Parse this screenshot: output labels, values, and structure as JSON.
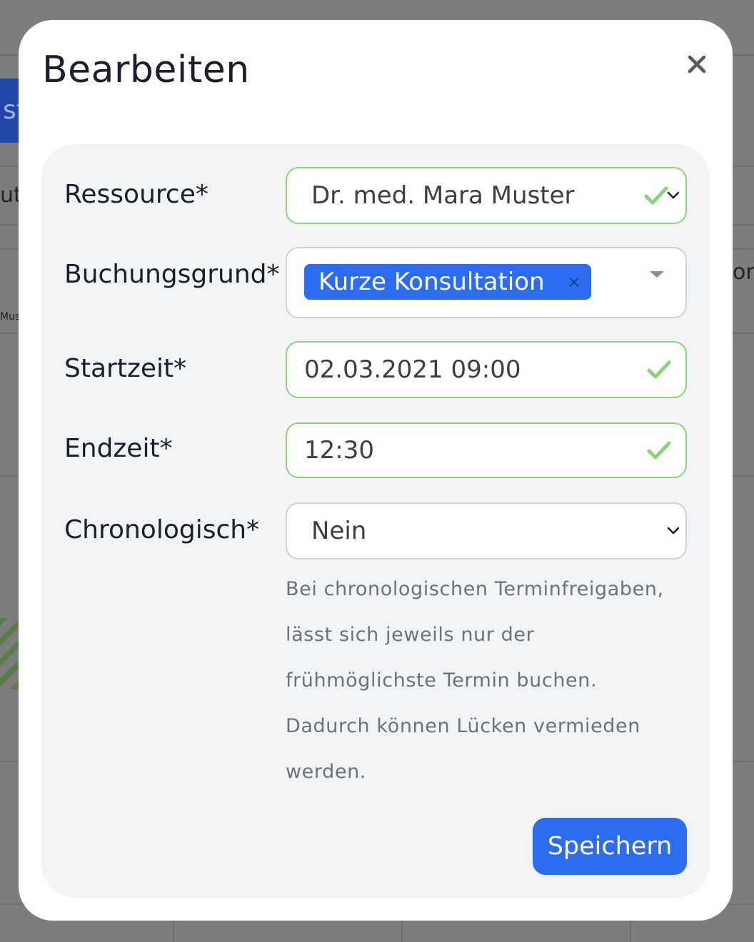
{
  "background": {
    "button_fragment": "st",
    "fragment_1": "ute",
    "fragment_2": "on",
    "fragment_3": "Mus"
  },
  "modal": {
    "title": "Bearbeiten",
    "close_icon": "close-icon",
    "form": {
      "resource": {
        "label": "Ressource*",
        "value": "Dr. med. Mara Muster",
        "valid": true
      },
      "reason": {
        "label": "Buchungsgrund*",
        "tag": "Kurze Konsultation",
        "tag_remove": "×"
      },
      "start": {
        "label": "Startzeit*",
        "value": "02.03.2021 09:00",
        "valid": true
      },
      "end": {
        "label": "Endzeit*",
        "value": "12:30",
        "valid": true
      },
      "chronological": {
        "label": "Chronologisch*",
        "value": "Nein",
        "help": "Bei chronologischen Terminfreigaben, lässt sich jeweils nur der frühmöglichste Termin buchen. Dadurch können Lücken vermieden werden."
      }
    },
    "save_label": "Speichern"
  },
  "colors": {
    "accent": "#2c6cf0",
    "valid": "#8fd07d",
    "overlay": "#7d7d7d"
  }
}
